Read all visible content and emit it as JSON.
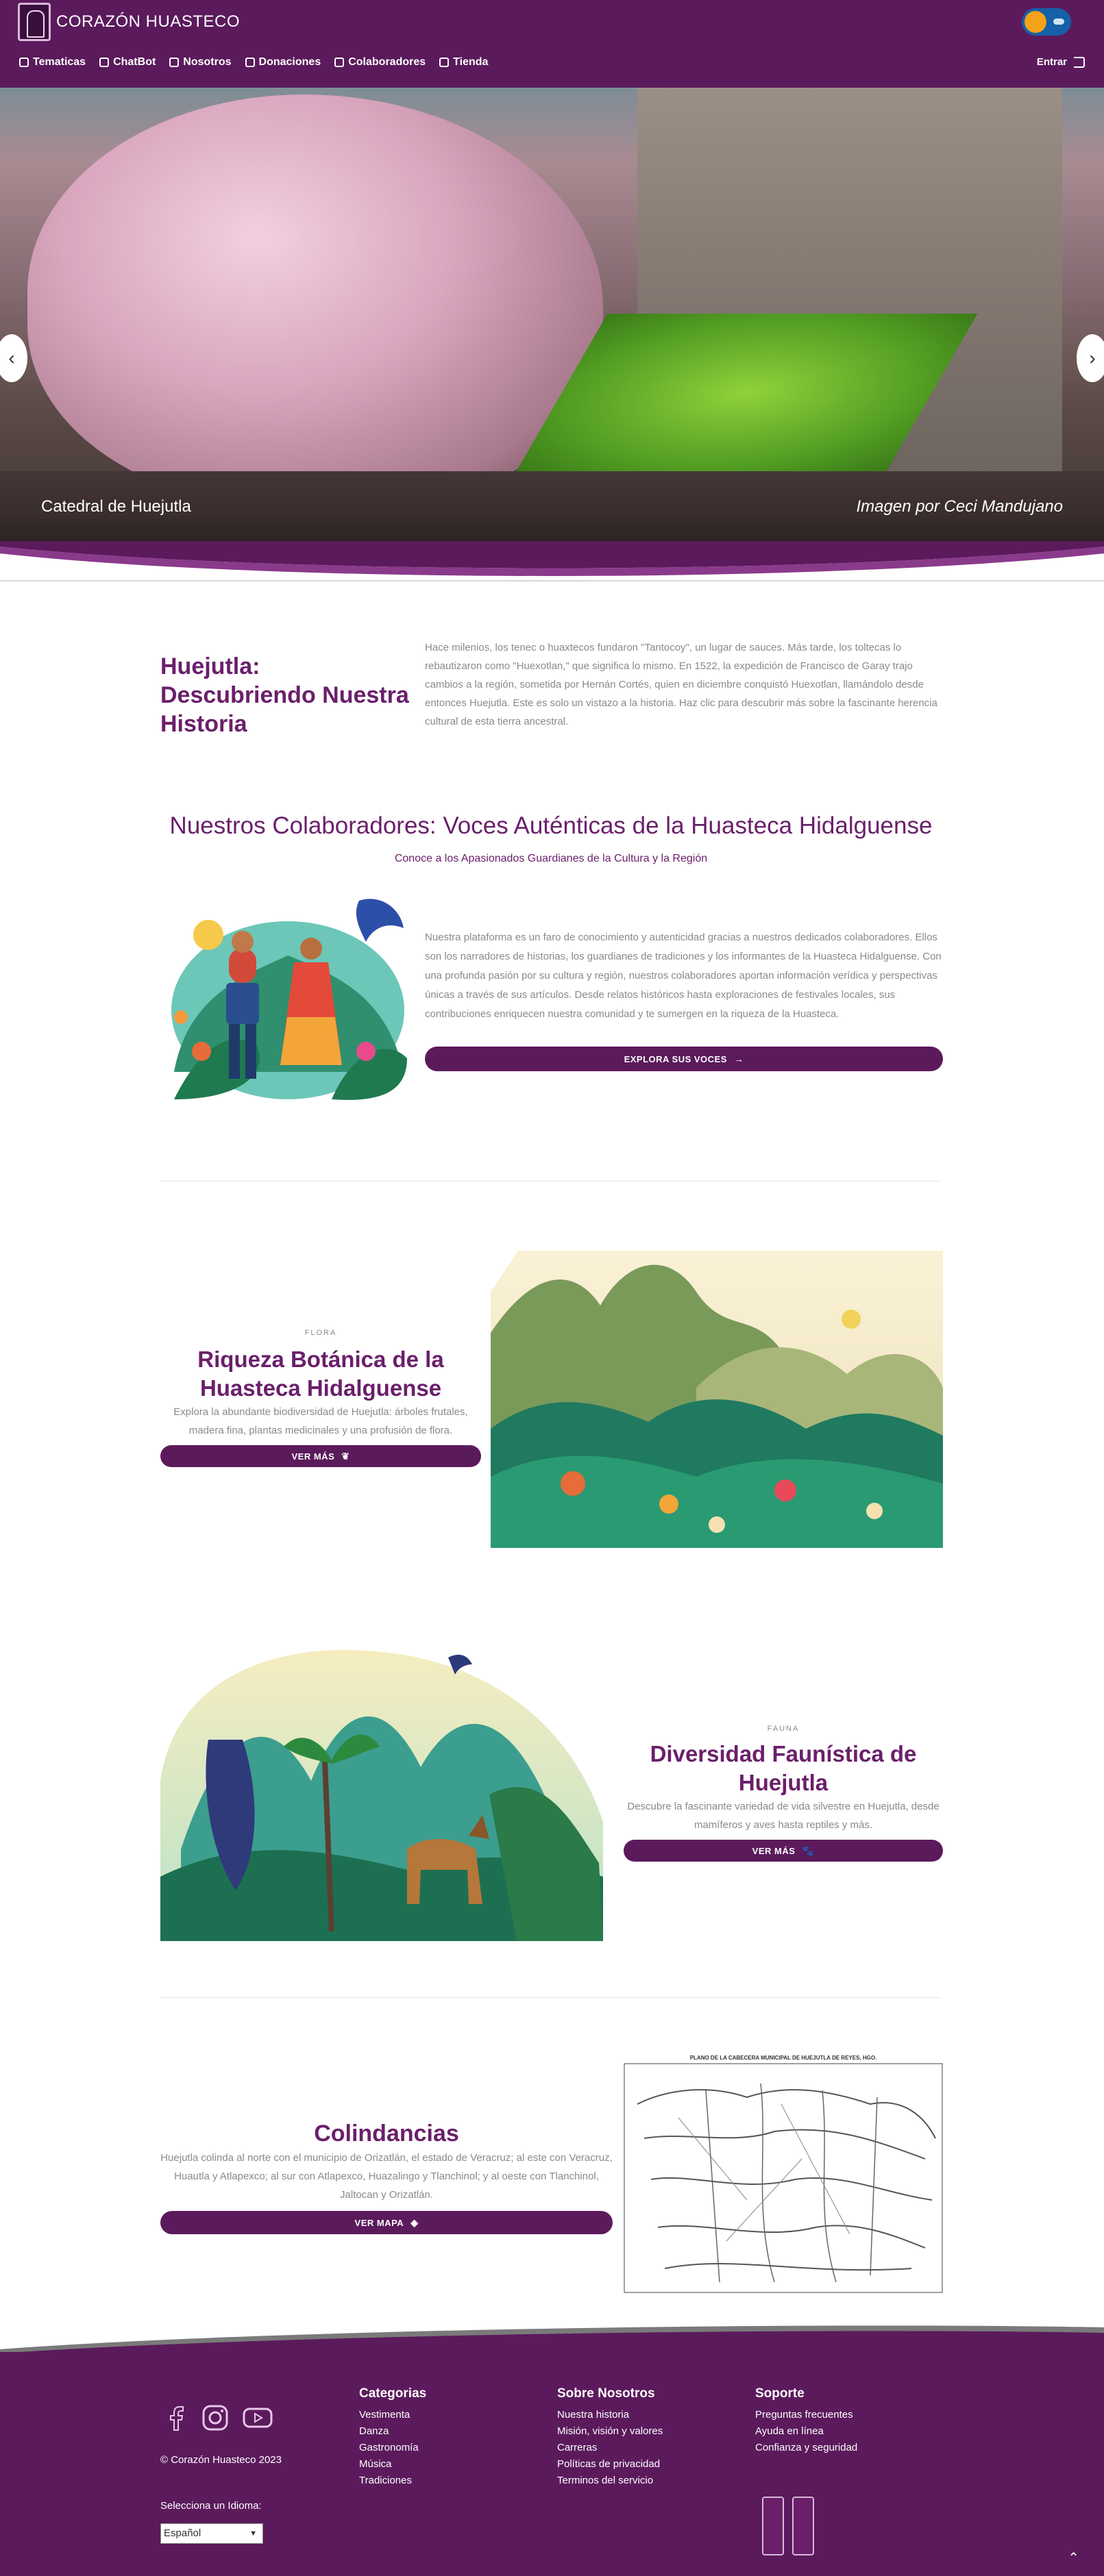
{
  "brand": {
    "title": "CORAZÓN HUASTECO"
  },
  "nav": {
    "items": [
      {
        "label": "Tematicas",
        "icon": "tag-icon"
      },
      {
        "label": "ChatBot",
        "icon": "robot-icon"
      },
      {
        "label": "Nosotros",
        "icon": "institution-icon"
      },
      {
        "label": "Donaciones",
        "icon": "hand-holding-icon"
      },
      {
        "label": "Colaboradores",
        "icon": "book-icon"
      },
      {
        "label": "Tienda",
        "icon": "store-icon"
      }
    ],
    "login_label": "Entrar"
  },
  "hero": {
    "caption": "Catedral de Huejutla",
    "credit": "Imagen por Ceci Mandujano",
    "prev_symbol": "‹",
    "next_symbol": "›"
  },
  "history": {
    "title": "Huejutla: Descubriendo Nuestra Historia",
    "text": "Hace milenios, los tenec o huaxtecos fundaron \"Tantocoy\", un lugar de sauces. Más tarde, los toltecas lo rebautizaron como \"Huexotlan,\" que significa lo mismo. En 1522, la expedición de Francisco de Garay trajo cambios a la región, sometida por Hernán Cortés, quien en diciembre conquistó Huexotlan, llamándolo desde entonces Huejutla. Este es solo un vistazo a la historia. Haz clic para descubrir más sobre la fascinante herencia cultural de esta tierra ancestral."
  },
  "collaborators": {
    "title": "Nuestros Colaboradores: Voces Auténticas de la Huasteca Hidalguense",
    "subtitle": "Conoce a los Apasionados Guardianes de la Cultura y la Región",
    "text": "Nuestra plataforma es un faro de conocimiento y autenticidad gracias a nuestros dedicados colaboradores. Ellos son los narradores de historias, los guardianes de tradiciones y los informantes de la Huasteca Hidalguense. Con una profunda pasión por su cultura y región, nuestros colaboradores aportan información verídica y perspectivas únicas a través de sus artículos. Desde relatos históricos hasta exploraciones de festivales locales, sus contribuciones enriquecen nuestra comunidad y te sumergen en la riqueza de la Huasteca.",
    "button_label": "EXPLORA SUS VOCES",
    "button_symbol": "→"
  },
  "flora": {
    "eyebrow": "FLORA",
    "title": "Riqueza Botánica de la Huasteca Hidalguense",
    "text": "Explora la abundante biodiversidad de Huejutla: árboles frutales, madera fina, plantas medicinales y una profusión de flora.",
    "button_label": "VER MÁS",
    "button_symbol": "❦"
  },
  "fauna": {
    "eyebrow": "FAUNA",
    "title": "Diversidad Faunística de Huejutla",
    "text": "Descubre la fascinante variedad de vida silvestre en Huejutla, desde mamíferos y aves hasta reptiles y más.",
    "button_label": "VER MÁS",
    "button_symbol": "🐾"
  },
  "borders": {
    "title": "Colindancias",
    "text": "Huejutla colinda al norte con el municipio de Orizatlán, el estado de Veracruz; al este con Veracruz, Huautla y Atlapexco; al sur con Atlapexco, Huazalingo y Tlanchinol; y al oeste con Tlanchinol, Jaltocan y Orizatlán.",
    "button_label": "VER MAPA",
    "button_symbol": "◈",
    "map_title": "PLANO DE LA CABECERA MUNICIPAL DE HUEJUTLA DE REYES, HGO."
  },
  "footer": {
    "copyright": "© Corazón Huasteco 2023",
    "language_label": "Selecciona un Idioma:",
    "language_value": "Español",
    "columns": [
      {
        "title": "Categorias",
        "links": [
          "Vestimenta",
          "Danza",
          "Gastronomía",
          "Música",
          "Tradiciones"
        ]
      },
      {
        "title": "Sobre Nosotros",
        "links": [
          "Nuestra historia",
          "Misión, visión y valores",
          "Carreras",
          "Políticas de privacidad",
          "Terminos del servicio"
        ]
      },
      {
        "title": "Soporte",
        "links": [
          "Preguntas frecuentes",
          "Ayuda en línea",
          "Confianza y seguridad"
        ]
      }
    ],
    "social": [
      "facebook-icon",
      "instagram-icon",
      "youtube-icon"
    ],
    "to_top_symbol": "⌃"
  },
  "colors": {
    "brand_purple": "#5b1a5c",
    "heading_purple": "#6a1f6b",
    "muted_text": "#8a8a8a"
  }
}
